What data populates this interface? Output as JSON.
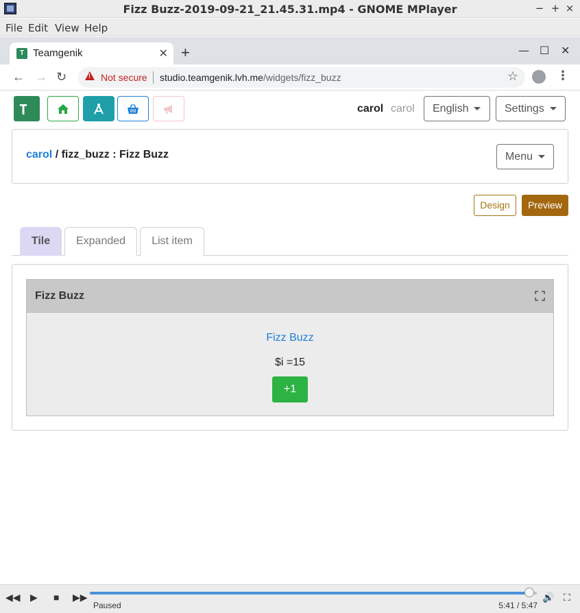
{
  "window": {
    "title": "Fizz Buzz-2019-09-21_21.45.31.mp4 - GNOME MPlayer",
    "controls": [
      "−",
      "+",
      "×"
    ]
  },
  "menubar": [
    "File",
    "Edit",
    "View",
    "Help"
  ],
  "browser": {
    "tab_title": "Teamgenik",
    "new_tab": "+",
    "not_secure": "Not secure",
    "url_host": "studio.teamgenik.lvh.me",
    "url_path": "/widgets/fizz_buzz",
    "star": "☆"
  },
  "topnav": {
    "user_name": "carol",
    "user_handle": "carol",
    "language_label": "English",
    "settings_label": "Settings"
  },
  "breadcrumb": {
    "owner": "carol",
    "rest": " / fizz_buzz : Fizz Buzz",
    "menu_label": "Menu"
  },
  "mode": {
    "design_label": "Design",
    "preview_label": "Preview"
  },
  "view_tabs": [
    {
      "label": "Tile"
    },
    {
      "label": "Expanded"
    },
    {
      "label": "List item"
    }
  ],
  "widget": {
    "title": "Fizz Buzz",
    "link_text": "Fizz Buzz",
    "value_text": "$i =15",
    "button_label": "+1"
  },
  "player": {
    "status": "Paused",
    "time": "5:41 /  5:47",
    "progress": 0.9827
  },
  "colors": {
    "accent_green": "#28a745",
    "teal": "#1fa0a8",
    "blue": "#1c7ed6",
    "preview_gold": "#a3680f",
    "tab_active": "#dcd8f4"
  }
}
